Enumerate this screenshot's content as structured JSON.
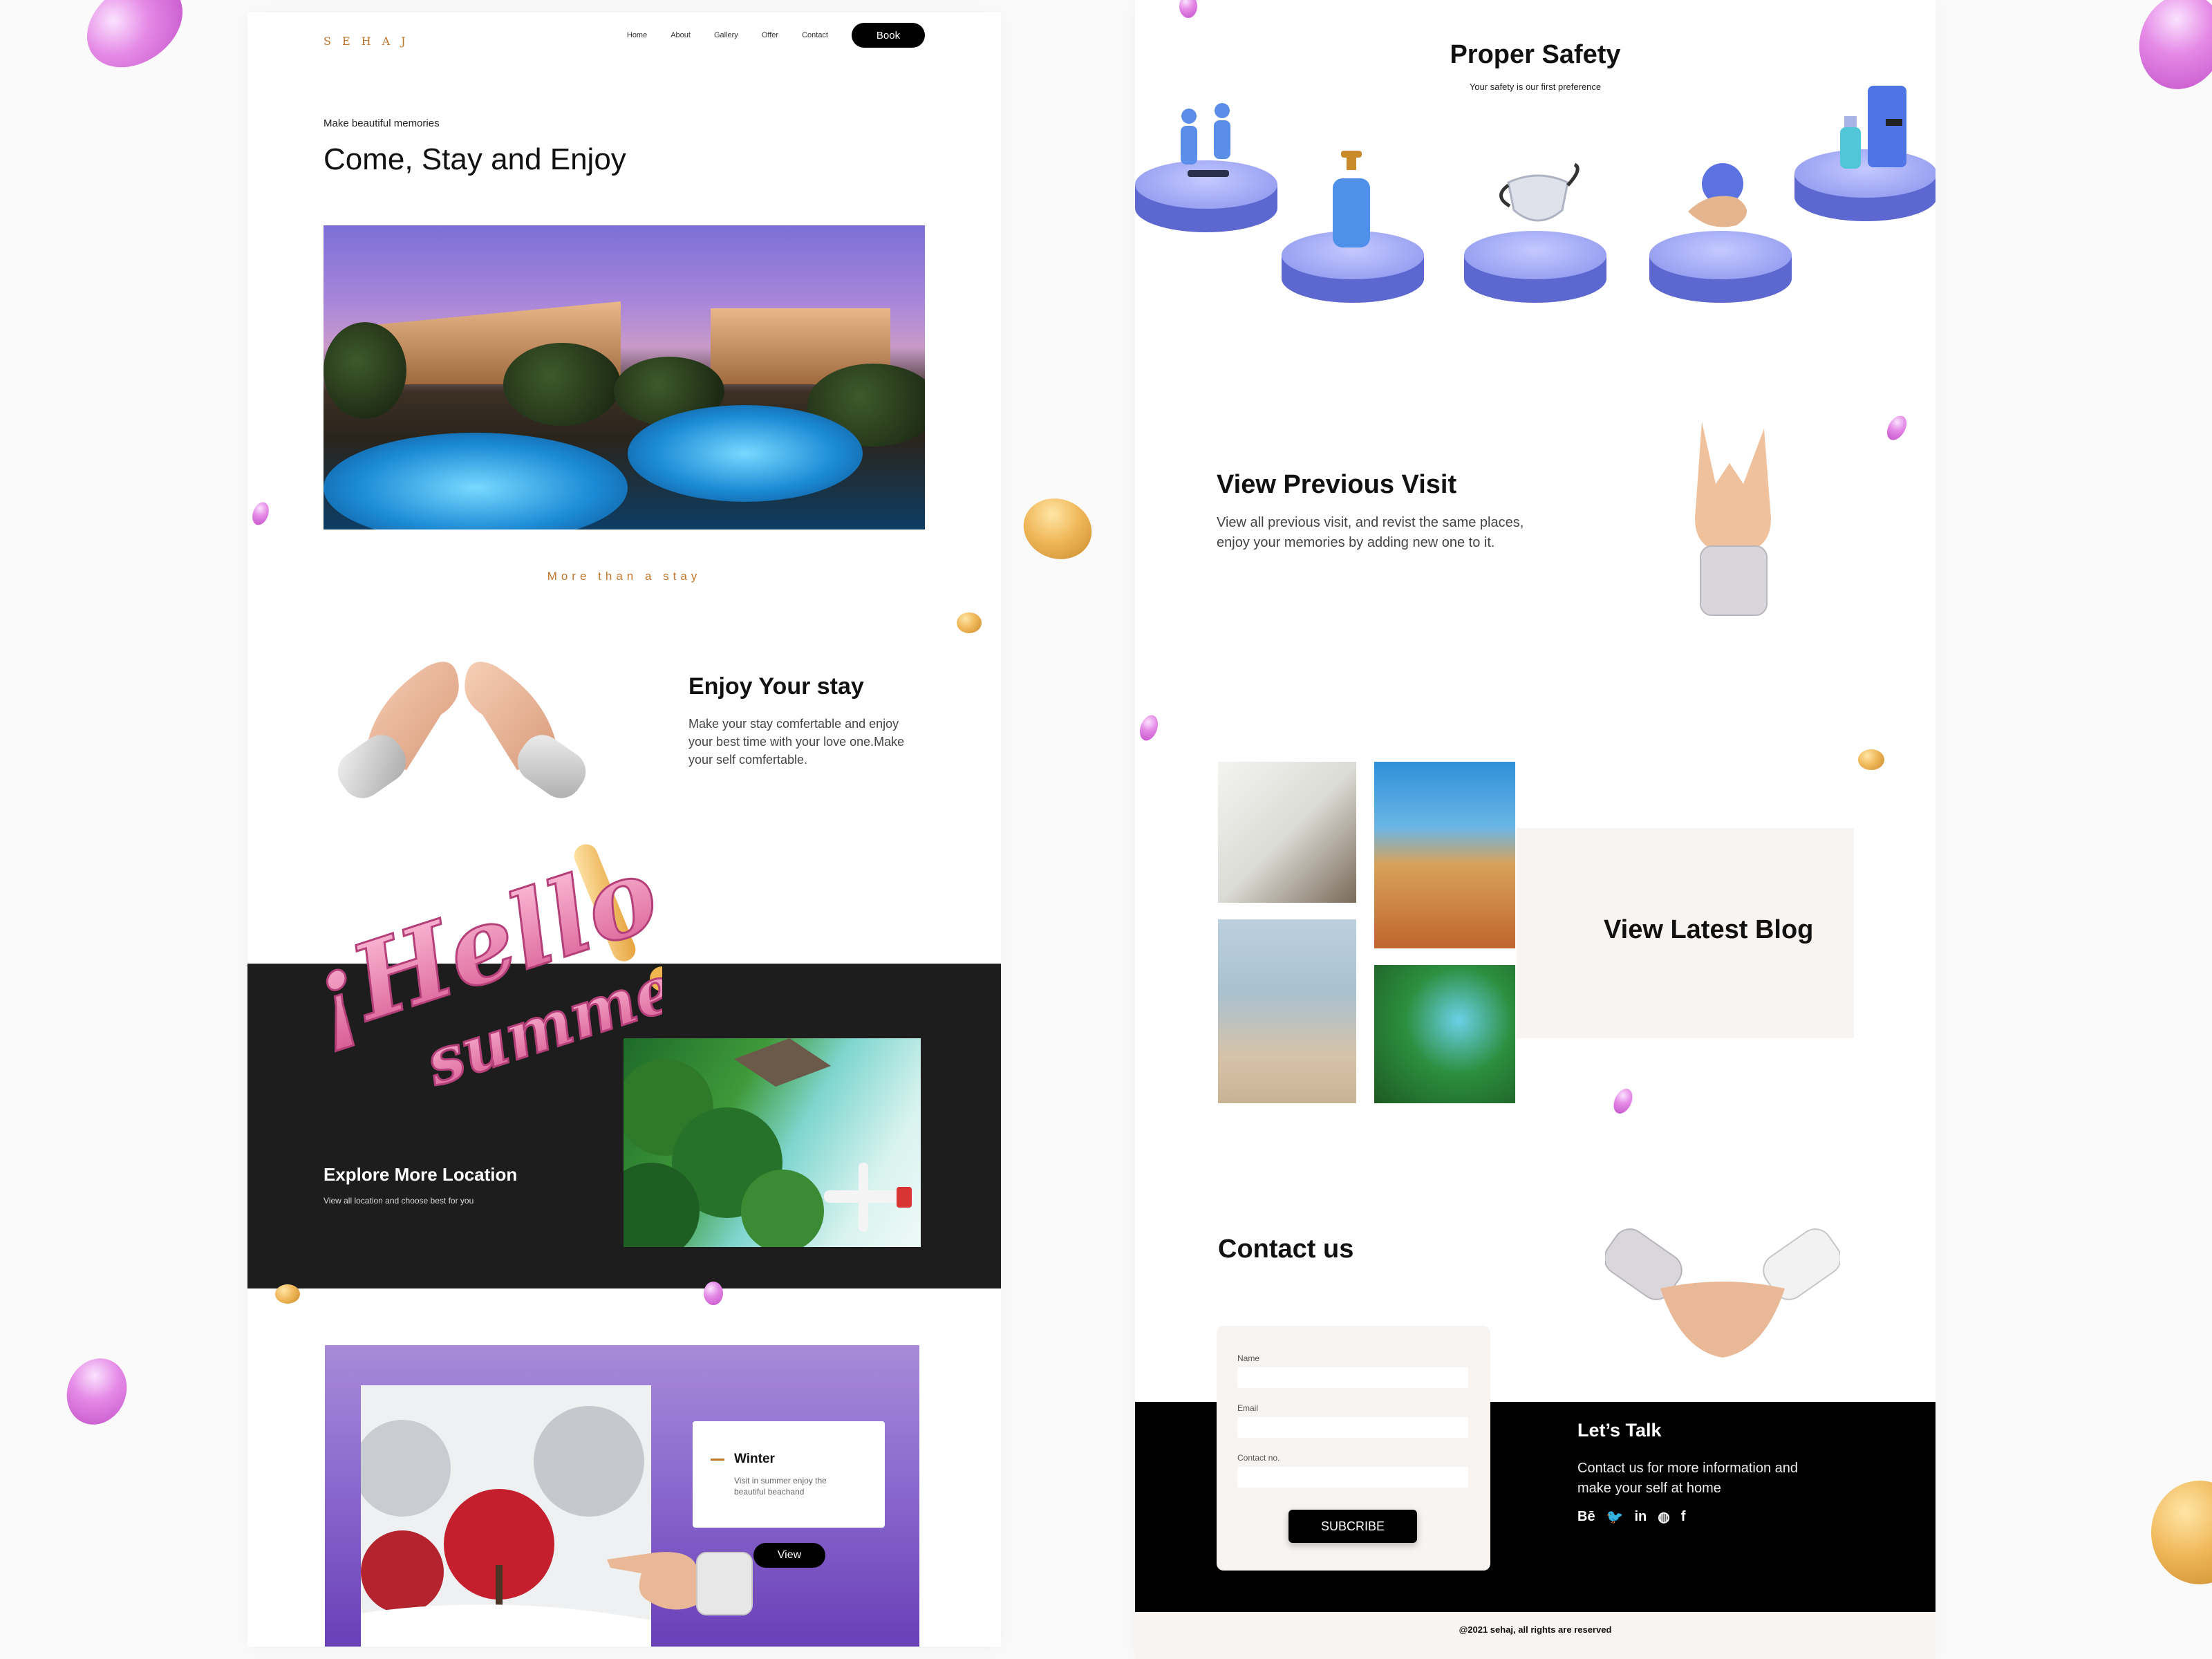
{
  "colors": {
    "accent": "#c0752a",
    "dark_band": "#1d1d1d",
    "pedestal": "#5d67d0",
    "winter_gradient_top": "#a88ad8",
    "winter_gradient_bottom": "#6a3fb8",
    "cream": "#f8f4f1"
  },
  "left": {
    "logo": "SEHAJ",
    "nav": {
      "home": "Home",
      "about": "About",
      "gallery": "Gallery",
      "offer": "Offer",
      "contact": "Contact",
      "book": "Book"
    },
    "hero": {
      "tagline": "Make beautiful memories",
      "title": "Come, Stay and Enjoy"
    },
    "more_stay": "More than a stay",
    "enjoy": {
      "title": "Enjoy Your stay",
      "text": "Make your stay comfertable and enjoy your best time with your love one.Make your self comfertable."
    },
    "hello_graphic": {
      "line1": "¡Hello",
      "line2": "summer"
    },
    "explore": {
      "title": "Explore More Location",
      "text": "View all location and choose best for you"
    },
    "winter": {
      "title": "Winter",
      "text": "Visit in summer  enjoy the beautiful beachand",
      "button": "View"
    }
  },
  "right": {
    "safety": {
      "title": "Proper Safety",
      "subtitle": "Your safety is our first preference",
      "icons": [
        "social-distance-icon",
        "sanitizer-icon",
        "face-mask-icon",
        "hand-wash-icon",
        "door-disinfect-icon"
      ]
    },
    "visit": {
      "title": "View Previous Visit",
      "text": "View all previous visit, and revist the same places, enjoy your memories by adding new one to it."
    },
    "blog": {
      "title": "View Latest Blog"
    },
    "contact": {
      "title": "Contact us",
      "form": {
        "name_label": "Name",
        "email_label": "Email",
        "contact_label": "Contact no.",
        "submit": "SUBCRIBE"
      },
      "talk_title": "Let’s Talk",
      "talk_text": "Contact us for more information and make your self at home",
      "socials": {
        "behance": "Bē",
        "twitter": "🐦",
        "linkedin": "in",
        "dribbble": "◍",
        "facebook": "f"
      }
    },
    "footer": {
      "copyright": "@2021 sehaj, all rights are reserved"
    }
  }
}
